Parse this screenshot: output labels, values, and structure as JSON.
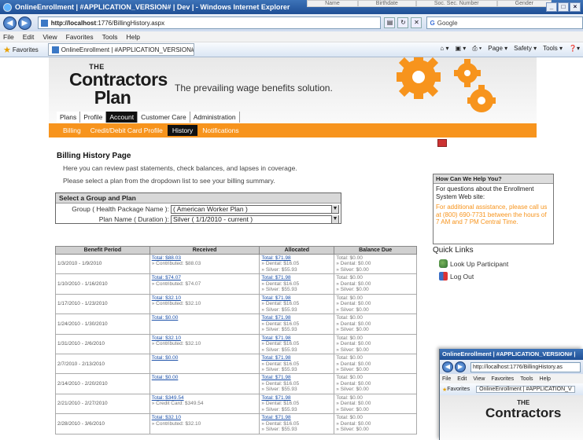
{
  "browser": {
    "window_title": "OnlineEnrollment | #APPLICATION_VERSION# | Dev | - Windows Internet Explorer",
    "bg_columns": [
      "Name",
      "Birthdate",
      "Soc. Sec. Number",
      "Gender"
    ],
    "url_host": "http://localhost",
    "url_path": ":1776/BillingHistory.aspx",
    "search_placeholder": "Google",
    "menu": [
      "File",
      "Edit",
      "View",
      "Favorites",
      "Tools",
      "Help"
    ],
    "favorites_label": "Favorites",
    "tab_label": "OnlineEnrollment | #APPLICATION_VERSION# | Dev |",
    "commands": [
      "Page ▾",
      "Safety ▾",
      "Tools ▾"
    ]
  },
  "site": {
    "logo_the": "THE",
    "logo_line1": "Contractors",
    "logo_line2": "Plan",
    "tagline": "The prevailing wage benefits solution.",
    "main_nav": [
      "Plans",
      "Profile",
      "Account",
      "Customer Care",
      "Administration"
    ],
    "main_nav_active": "Account",
    "sub_nav": [
      "Billing",
      "Credit/Debit Card Profile",
      "History",
      "Notifications"
    ],
    "sub_nav_active": "History",
    "accent_color": "#f7941d"
  },
  "page": {
    "heading": "Billing History Page",
    "intro1": "Here you can review past statements, check balances, and lapses in coverage.",
    "intro2": "Please select a plan from the dropdown list to see your billing summary."
  },
  "selector": {
    "title": "Select a Group and Plan",
    "group_label": "Group ( Health Package Name ):",
    "group_value": "( American Worker Plan )",
    "plan_label": "Plan Name ( Duration ):",
    "plan_value": "Silver ( 1/1/2010 - current )"
  },
  "table": {
    "headers": [
      "Benefit Period",
      "Received",
      "Allocated",
      "Balance Due"
    ],
    "rows": [
      {
        "period": "1/3/2010 - 1/9/2010",
        "received_total": "Total: $88.03",
        "received_sub": "» Contributed: $88.03",
        "alloc_total": "Total: $71.98",
        "alloc_dental": "» Dental: $16.05",
        "alloc_silver": "» Silver: $55.93",
        "bal_total": "Total: $0.00",
        "bal_dental": "» Dental: $0.00",
        "bal_silver": "» Silver: $0.00"
      },
      {
        "period": "1/10/2010 - 1/16/2010",
        "received_total": "Total: $74.07",
        "received_sub": "» Contributed: $74.07",
        "alloc_total": "Total: $71.98",
        "alloc_dental": "» Dental: $16.05",
        "alloc_silver": "» Silver: $55.93",
        "bal_total": "Total: $0.00",
        "bal_dental": "» Dental: $0.00",
        "bal_silver": "» Silver: $0.00"
      },
      {
        "period": "1/17/2010 - 1/23/2010",
        "received_total": "Total: $32.10",
        "received_sub": "» Contributed: $32.10",
        "alloc_total": "Total: $71.98",
        "alloc_dental": "» Dental: $16.05",
        "alloc_silver": "» Silver: $55.93",
        "bal_total": "Total: $0.00",
        "bal_dental": "» Dental: $0.00",
        "bal_silver": "» Silver: $0.00"
      },
      {
        "period": "1/24/2010 - 1/30/2010",
        "received_total": "Total: $0.00",
        "received_sub": "",
        "alloc_total": "Total: $71.98",
        "alloc_dental": "» Dental: $16.05",
        "alloc_silver": "» Silver: $55.93",
        "bal_total": "Total: $0.00",
        "bal_dental": "» Dental: $0.00",
        "bal_silver": "» Silver: $0.00"
      },
      {
        "period": "1/31/2010 - 2/6/2010",
        "received_total": "Total: $32.10",
        "received_sub": "» Contributed: $32.10",
        "alloc_total": "Total: $71.98",
        "alloc_dental": "» Dental: $16.05",
        "alloc_silver": "» Silver: $55.93",
        "bal_total": "Total: $0.00",
        "bal_dental": "» Dental: $0.00",
        "bal_silver": "» Silver: $0.00"
      },
      {
        "period": "2/7/2010 - 2/13/2010",
        "received_total": "Total: $0.00",
        "received_sub": "",
        "alloc_total": "Total: $71.98",
        "alloc_dental": "» Dental: $16.05",
        "alloc_silver": "» Silver: $55.93",
        "bal_total": "Total: $0.00",
        "bal_dental": "» Dental: $0.00",
        "bal_silver": "» Silver: $0.00"
      },
      {
        "period": "2/14/2010 - 2/20/2010",
        "received_total": "Total: $0.00",
        "received_sub": "",
        "alloc_total": "Total: $71.98",
        "alloc_dental": "» Dental: $16.05",
        "alloc_silver": "» Silver: $55.93",
        "bal_total": "Total: $0.00",
        "bal_dental": "» Dental: $0.00",
        "bal_silver": "» Silver: $0.00"
      },
      {
        "period": "2/21/2010 - 2/27/2010",
        "received_total": "Total: $349.54",
        "received_sub": "» Credit Card: $349.54",
        "alloc_total": "Total: $71.98",
        "alloc_dental": "» Dental: $16.05",
        "alloc_silver": "» Silver: $55.93",
        "bal_total": "Total: $0.00",
        "bal_dental": "» Dental: $0.00",
        "bal_silver": "» Silver: $0.00"
      },
      {
        "period": "2/28/2010 - 3/6/2010",
        "received_total": "Total: $32.10",
        "received_sub": "» Contributed: $32.10",
        "alloc_total": "Total: $71.98",
        "alloc_dental": "» Dental: $16.05",
        "alloc_silver": "» Silver: $55.93",
        "bal_total": "Total: $0.00",
        "bal_dental": "» Dental: $0.00",
        "bal_silver": "» Silver: $0.00"
      }
    ]
  },
  "help": {
    "title": "How Can We Help You?",
    "question": "For questions about the Enrollment System Web site:",
    "call": "For additional assistance, please call us at (800) 690-7731 between the hours of 7 AM and 7 PM Central Time."
  },
  "quick_links": {
    "title": "Quick Links",
    "items": [
      "Look Up Participant",
      "Log Out"
    ]
  },
  "second_window": {
    "title": "OnlineEnrollment | #APPLICATION_VERSION# | ",
    "url": "http://localhost:1776/BillingHistory.as",
    "menu": [
      "File",
      "Edit",
      "View",
      "Favorites",
      "Tools",
      "Help"
    ],
    "favorites_label": "Favorites",
    "tab_label": "OnlineEnrollment | #APPLICATION_V",
    "logo_the": "THE",
    "logo_big": "Contractors"
  }
}
